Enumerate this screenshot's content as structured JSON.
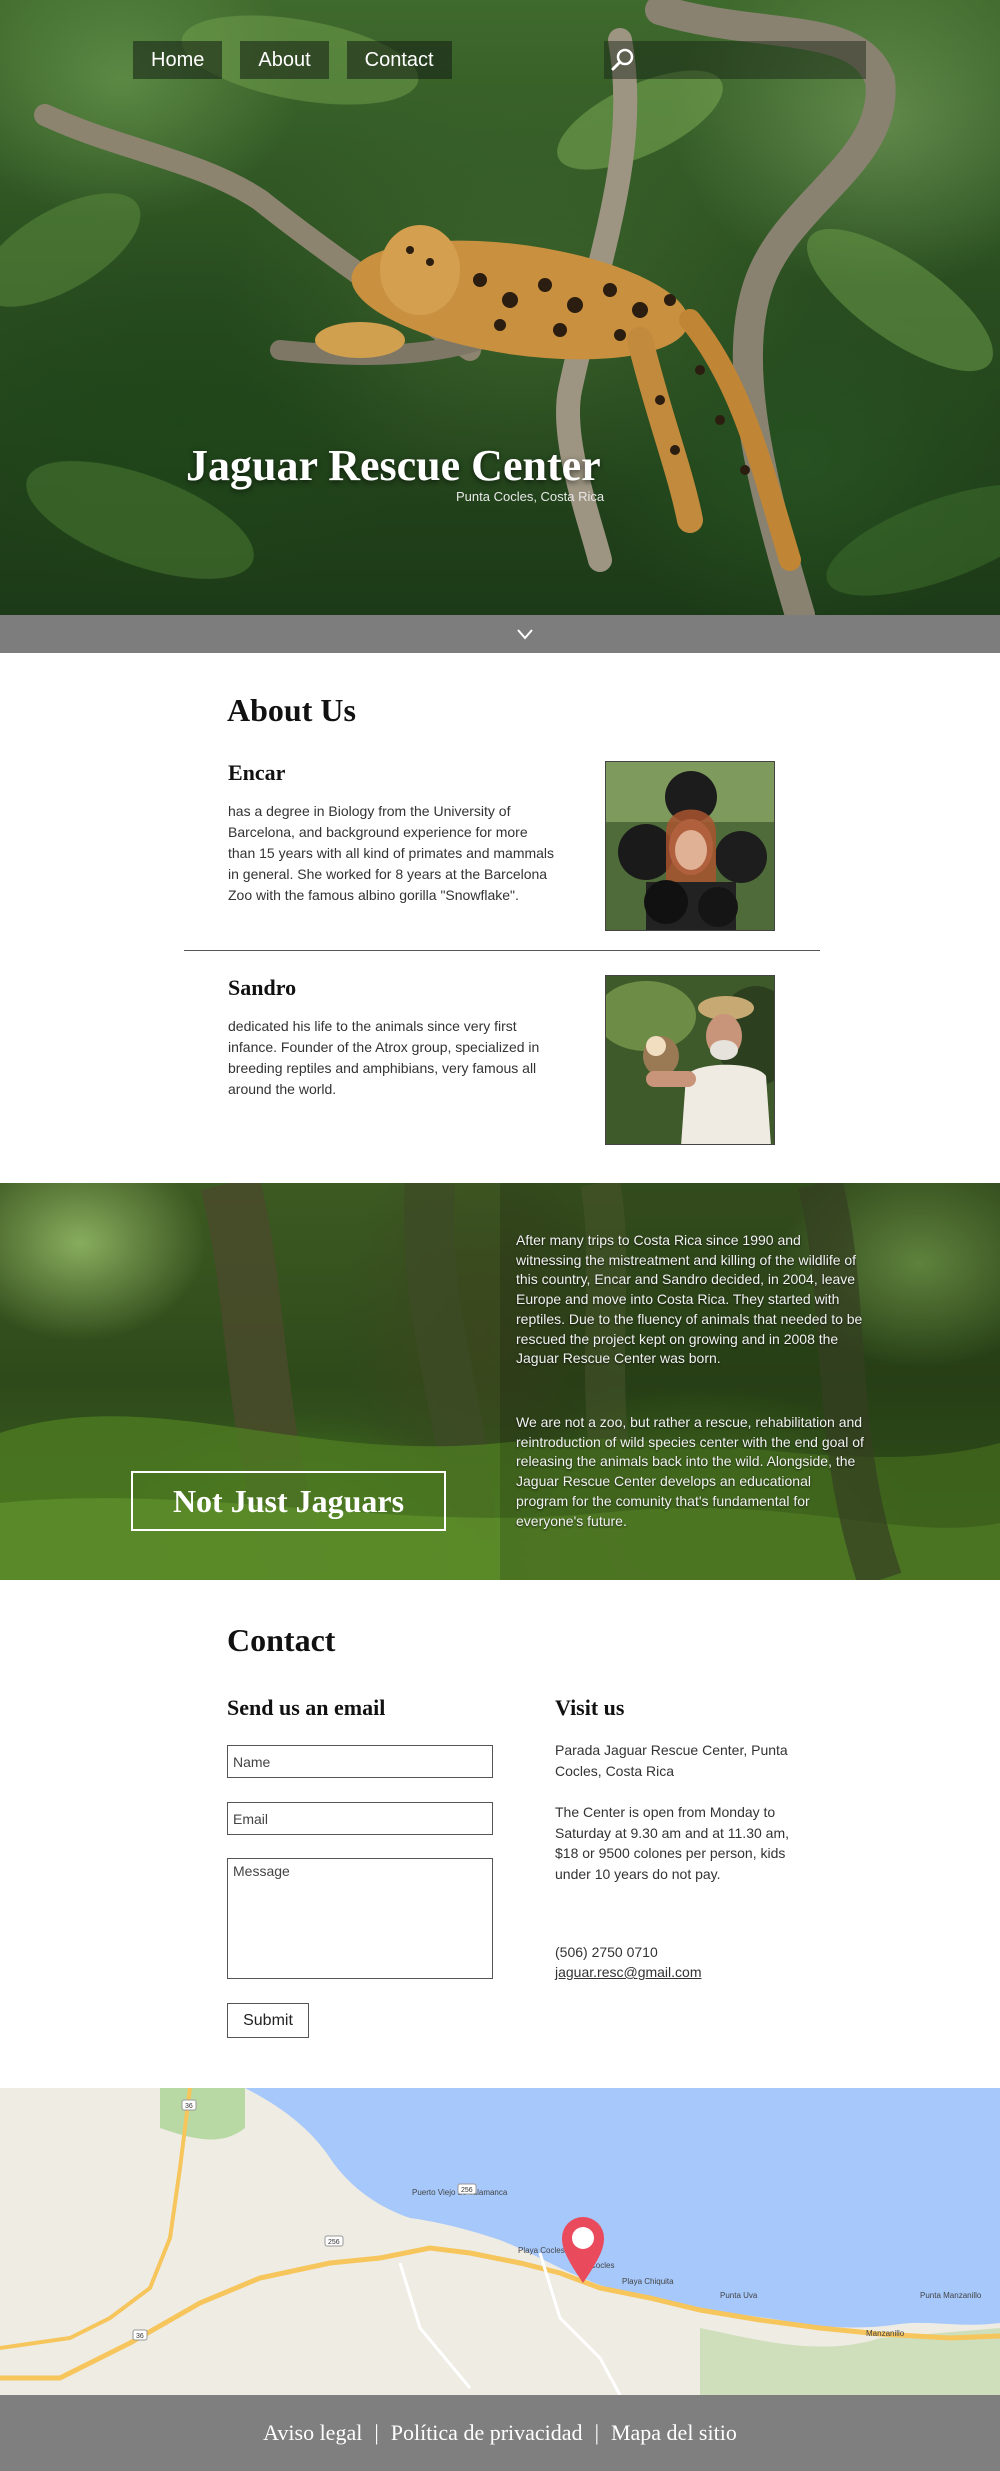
{
  "nav": {
    "items": [
      {
        "label": "Home"
      },
      {
        "label": "About"
      },
      {
        "label": "Contact"
      }
    ],
    "search_placeholder": ""
  },
  "hero": {
    "title": "Jaguar Rescue Center",
    "subtitle": "Punta Cocles, Costa Rica"
  },
  "about": {
    "title": "About Us",
    "people": [
      {
        "name": "Encar",
        "bio": "has a degree in Biology from the University of Barcelona, and background experience for more than 15 years with all kind of primates and mammals in general. She worked for 8 years at the Barcelona Zoo with the famous albino gorilla \"Snowflake\"."
      },
      {
        "name": "Sandro",
        "bio": "dedicated his life to the animals since very first infance. Founder of the Atrox group, specialized in breeding reptiles and amphibians, very famous all around the world."
      }
    ]
  },
  "feature": {
    "title": "Not Just Jaguars",
    "paragraph_1": "After many trips to Costa Rica since 1990 and witnessing the mistreatment and killing of the wildlife of this country, Encar and Sandro decided, in 2004, leave Europe and move into Costa Rica. They started with reptiles. Due to the fluency of animals that needed to be rescued the project kept on growing and in 2008 the Jaguar Rescue Center was born.",
    "paragraph_2": "We are not a zoo, but rather a rescue, rehabilitation and reintroduction of wild species center with the end goal of releasing the animals back into the wild. Alongside, the Jaguar Rescue Center develops an educational program for the comunity that's fundamental for everyone's future."
  },
  "contact": {
    "title": "Contact",
    "email_heading": "Send us an email",
    "name_placeholder": "Name",
    "email_placeholder": "Email",
    "message_placeholder": "Message",
    "submit_label": "Submit",
    "visit_heading": "Visit us",
    "address": "Parada Jaguar Rescue Center, Punta Cocles, Costa Rica",
    "hours": "The Center is open from Monday to Saturday at 9.30 am and at 11.30 am, $18 or 9500 colones per person, kids under 10 years do not pay.",
    "phone": "(506) 2750 0710",
    "email": "jaguar.resc@gmail.com"
  },
  "map": {
    "labels": {
      "puerto_viejo": "Puerto Viejo de Talamanca",
      "playa_cocles": "Playa Cocles",
      "cocles": "Cocles",
      "playa_chiquita": "Playa Chiquita",
      "punta_uva": "Punta Uva",
      "punta_manzanillo": "Punta Manzanillo",
      "manzanillo": "Manzanillo",
      "route_36a": "36",
      "route_36b": "36",
      "route_256a": "256",
      "route_256b": "256"
    },
    "colors": {
      "water": "#a6c8fb",
      "land": "#efece4",
      "road": "#f6c55c",
      "marker": "#e94a5c"
    }
  },
  "footer": {
    "links": [
      {
        "label": "Aviso legal"
      },
      {
        "label": "Política de privacidad"
      },
      {
        "label": "Mapa del sitio"
      }
    ],
    "separator": "|"
  }
}
